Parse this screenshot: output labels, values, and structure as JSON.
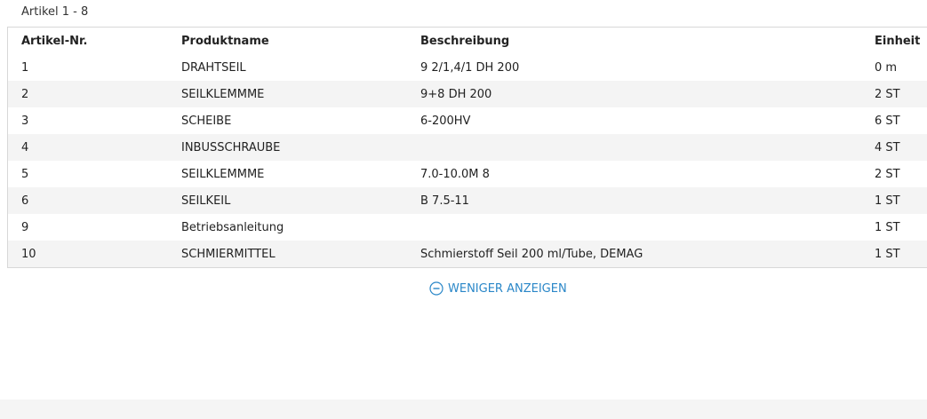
{
  "article_count": "Artikel 1 - 8",
  "table": {
    "headers": [
      "Artikel-Nr.",
      "Produktname",
      "Beschreibung",
      "Einheit"
    ],
    "rows": [
      [
        "1",
        "DRAHTSEIL",
        "9 2/1,4/1 DH 200",
        "0 m"
      ],
      [
        "2",
        "SEILKLEMMME",
        "9+8 DH 200",
        "2 ST"
      ],
      [
        "3",
        "SCHEIBE",
        "6-200HV",
        "6 ST"
      ],
      [
        "4",
        "INBUSSCHRAUBE",
        "",
        "4 ST"
      ],
      [
        "5",
        "SEILKLEMMME",
        "7.0-10.0M 8",
        "2 ST"
      ],
      [
        "6",
        "SEILKEIL",
        "B 7.5-11",
        "1 ST"
      ],
      [
        "9",
        "Betriebsanleitung",
        "",
        "1 ST"
      ],
      [
        "10",
        "SCHMIERMITTEL",
        "Schmierstoff Seil 200 ml/Tube, DEMAG",
        "1 ST"
      ]
    ]
  },
  "show_less": {
    "label": "WENIGER ANZEIGEN",
    "icon": "minus-circle-icon"
  },
  "colors": {
    "link": "#2a87c8",
    "row_alt": "#f4f4f4",
    "border": "#d8d8d8"
  }
}
